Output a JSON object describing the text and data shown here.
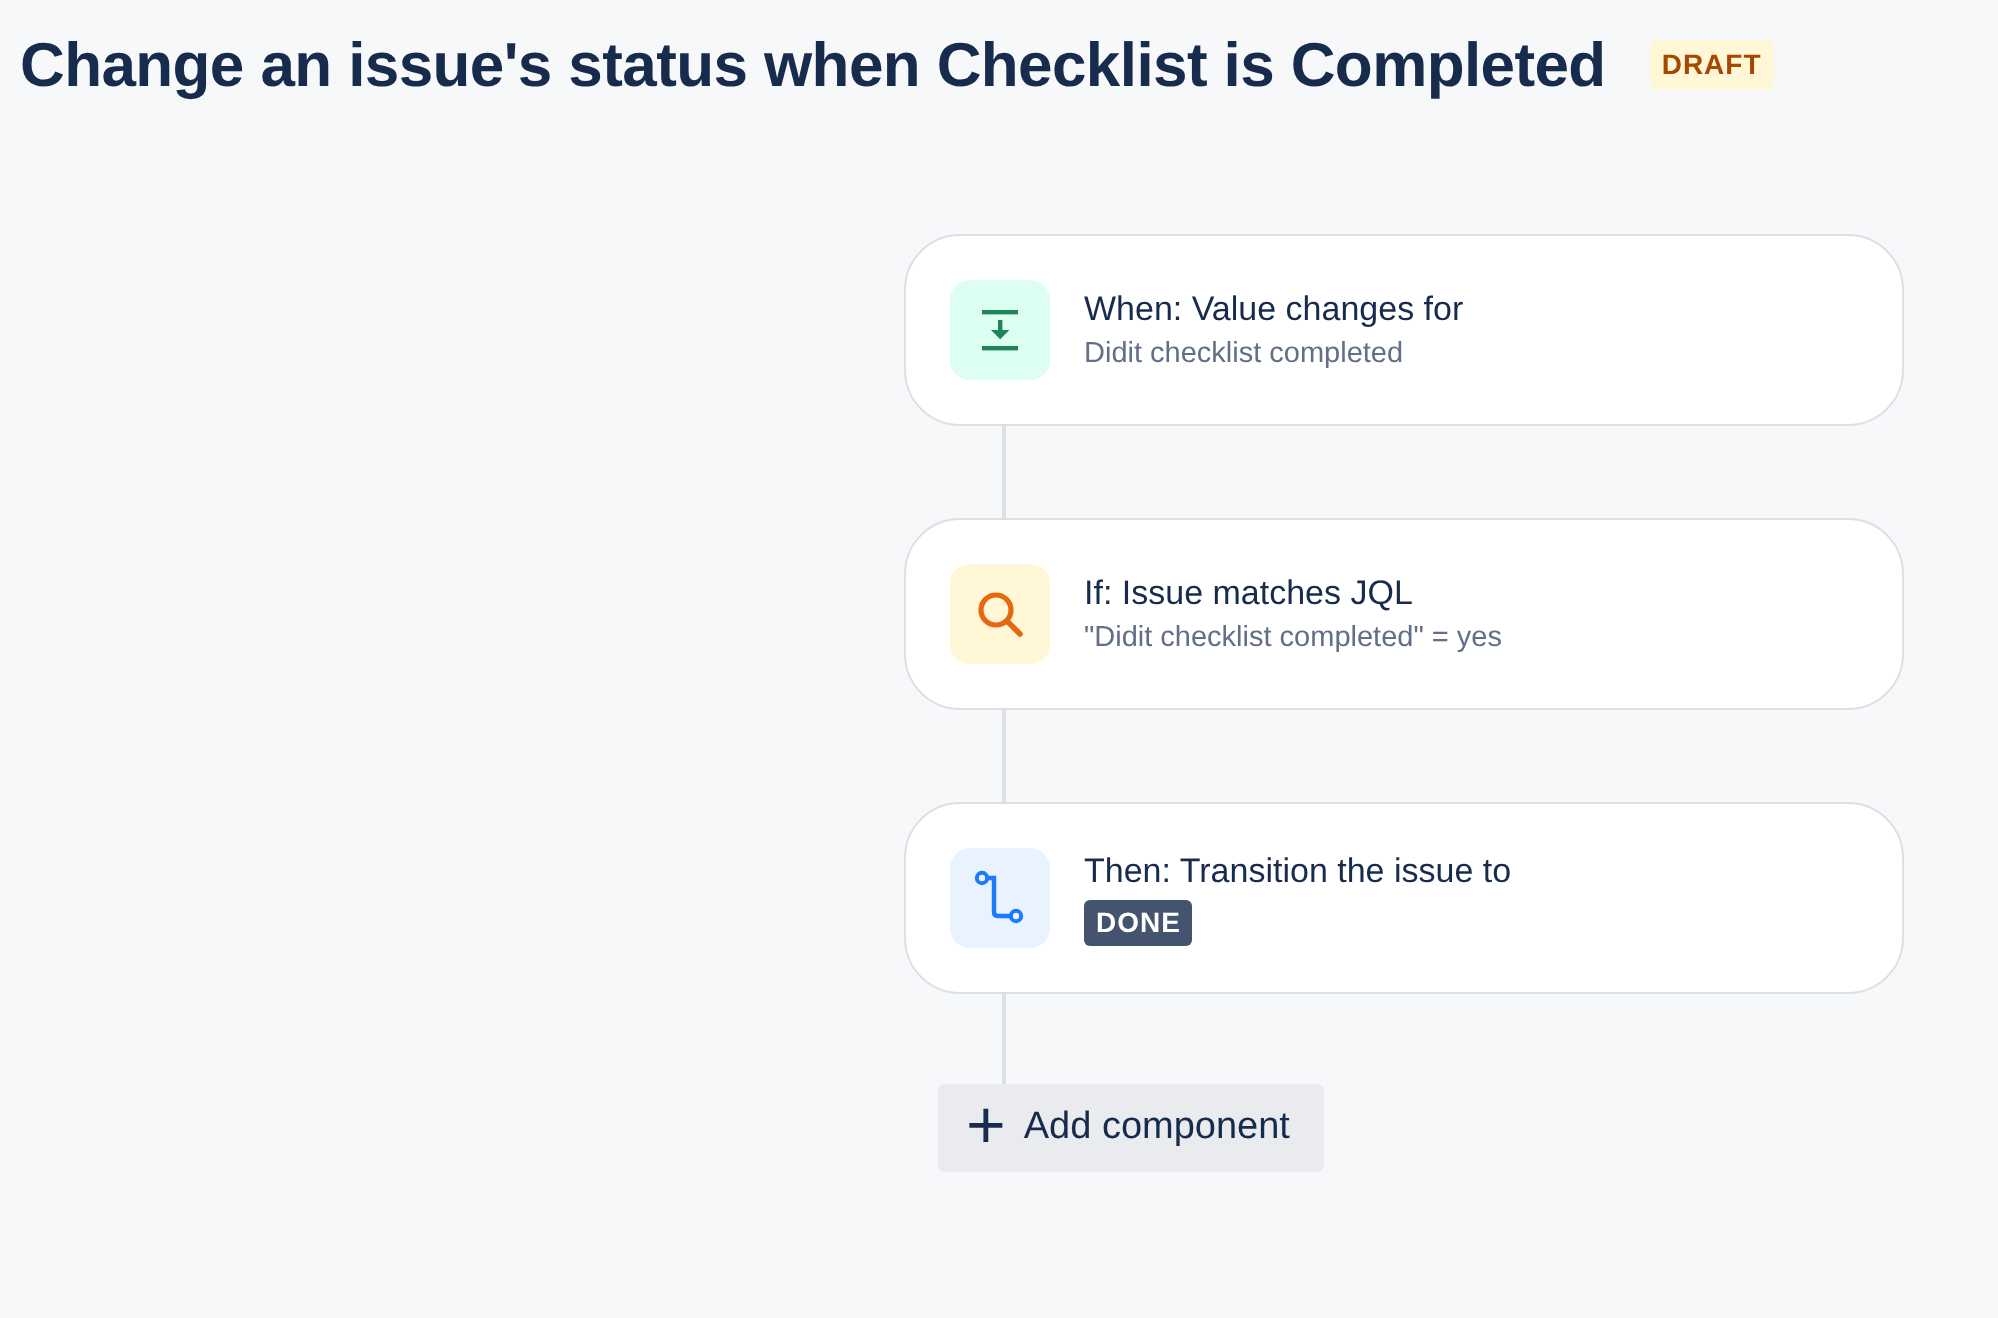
{
  "title": "Change an issue's status when Checklist is Completed",
  "status_badge": "DRAFT",
  "components": [
    {
      "kind": "trigger",
      "heading": "When: Value changes for",
      "detail": {
        "kind": "text",
        "text": "Didit checklist completed"
      }
    },
    {
      "kind": "condition",
      "heading": "If: Issue matches JQL",
      "detail": {
        "kind": "text",
        "text": "\"Didit checklist completed\" = yes"
      }
    },
    {
      "kind": "action",
      "heading": "Then: Transition the issue to",
      "detail": {
        "kind": "lozenge",
        "text": "DONE"
      }
    }
  ],
  "add_button": {
    "icon": "+",
    "label": "Add component"
  }
}
